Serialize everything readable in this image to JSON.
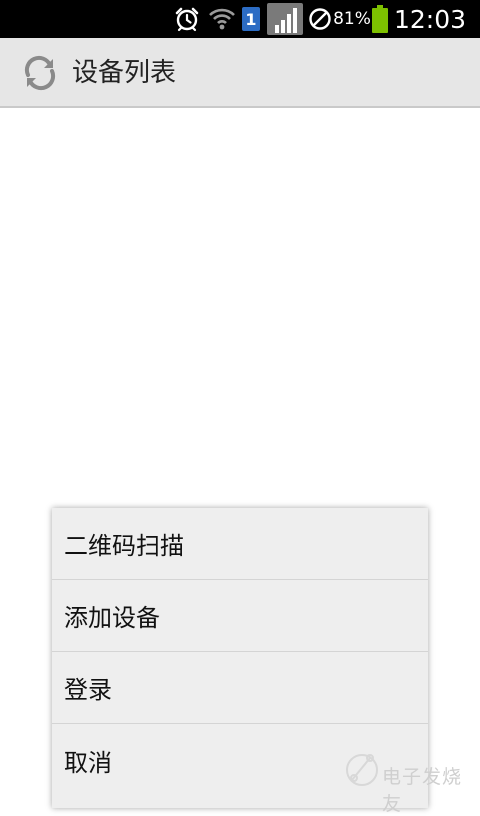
{
  "status_bar": {
    "battery_percent": "81%",
    "battery_level": 0.81,
    "time": "12:03",
    "sim_slot": "1",
    "icons": [
      "alarm-icon",
      "wifi-icon",
      "sim-card-icon",
      "signal-icon",
      "no-sync-icon",
      "battery-icon"
    ],
    "sim_color": "#2c6cc4",
    "battery_color": "#7dc000"
  },
  "action_bar": {
    "title": "设备列表",
    "refresh_icon": "refresh-icon",
    "background": "#e6e6e6"
  },
  "menu": {
    "items": [
      {
        "label": "二维码扫描"
      },
      {
        "label": "添加设备"
      },
      {
        "label": "登录"
      },
      {
        "label": "取消"
      }
    ],
    "background": "#eeeeee"
  },
  "watermark": {
    "text": "电子发烧友"
  }
}
